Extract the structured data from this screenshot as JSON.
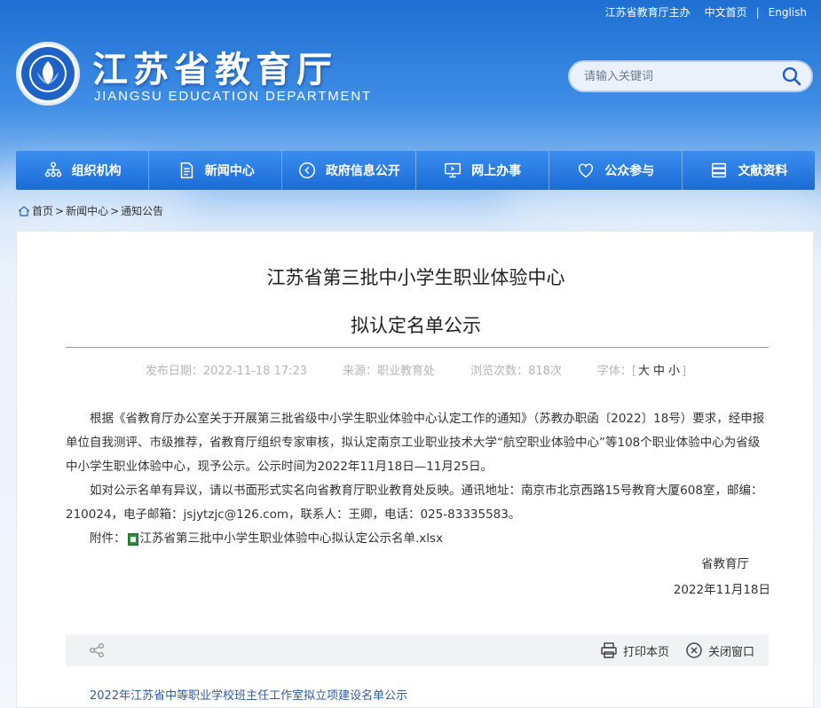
{
  "top_links": {
    "host": "江苏省教育厅主办",
    "cn_home": "中文首页",
    "sep": "|",
    "english": "English"
  },
  "header": {
    "title_cn": "江苏省教育厅",
    "title_en": "JIANGSU EDUCATION DEPARTMENT"
  },
  "search": {
    "placeholder": "请输入关键词"
  },
  "nav": [
    {
      "label": "组织机构",
      "icon": "org-chart-icon"
    },
    {
      "label": "新闻中心",
      "icon": "document-icon"
    },
    {
      "label": "政府信息公开",
      "icon": "arrow-circle-icon"
    },
    {
      "label": "网上办事",
      "icon": "monitor-icon"
    },
    {
      "label": "公众参与",
      "icon": "heart-icon"
    },
    {
      "label": "文献资料",
      "icon": "printer-books-icon"
    }
  ],
  "breadcrumb": {
    "home": "首页",
    "sep1": ">",
    "news": "新闻中心",
    "sep2": ">",
    "current": "通知公告"
  },
  "article": {
    "title_line1": "江苏省第三批中小学生职业体验中心",
    "title_line2": "拟认定名单公示",
    "publish_label": "发布日期：2022-11-18 17:23",
    "source_label": "来源：职业教育处",
    "views_label": "浏览次数：818次",
    "font_label": "字体：",
    "font_open": "[",
    "font_large": "大",
    "font_mid": "中",
    "font_small": "小",
    "font_close": "]",
    "para1": "根据《省教育厅办公室关于开展第三批省级中小学生职业体验中心认定工作的通知》（苏教办职函〔2022〕18号）要求，经申报单位自我测评、市级推荐，省教育厅组织专家审核，拟认定南京工业职业技术大学“航空职业体验中心”等108个职业体验中心为省级中小学生职业体验中心，现予公示。公示时间为2022年11月18日—11月25日。",
    "para2": "如对公示名单有异议，请以书面形式实名向省教育厅职业教育处反映。通讯地址：南京市北京西路15号教育大厦608室，邮编：210024，电子邮箱：jsjytzjc@126.com，联系人：王卿，电话：025-83335583。",
    "attach_label": "附件：",
    "attach_file": "江苏省第三批中小学生职业体验中心拟认定公示名单.xlsx",
    "signer": "省教育厅",
    "sign_date": "2022年11月18日"
  },
  "toolbar": {
    "print": "打印本页",
    "close": "关闭窗口"
  },
  "related": {
    "link": "2022年江苏省中等职业学校班主任工作室拟立项建设名单公示"
  },
  "colors": {
    "nav_bg": "#1c6bd6",
    "accent": "#2f5d9e"
  }
}
